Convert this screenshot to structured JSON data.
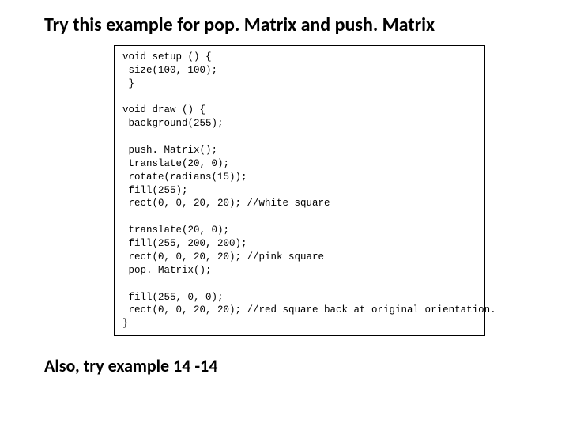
{
  "title": "Try this example for pop. Matrix and push. Matrix",
  "code": "void setup () {\n size(100, 100);\n }\n\nvoid draw () {\n background(255);\n\n push. Matrix();\n translate(20, 0);\n rotate(radians(15));\n fill(255);\n rect(0, 0, 20, 20); //white square\n\n translate(20, 0);\n fill(255, 200, 200);\n rect(0, 0, 20, 20); //pink square\n pop. Matrix();\n\n fill(255, 0, 0);\n rect(0, 0, 20, 20); //red square back at original orientation.\n}",
  "footnote": "Also, try example 14 -14"
}
